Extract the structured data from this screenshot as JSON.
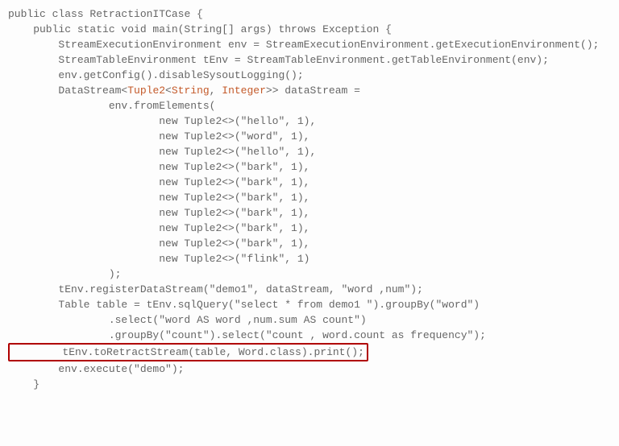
{
  "code": {
    "l1a": "public class ",
    "l1b": "RetractionITCase {",
    "l2": "    public static void main(String[] args) throws Exception {",
    "l3": "        StreamExecutionEnvironment env = StreamExecutionEnvironment.getExecutionEnvironment();",
    "l4": "        StreamTableEnvironment tEnv = StreamTableEnvironment.getTableEnvironment(env);",
    "l5": "        env.getConfig().disableSysoutLogging();",
    "l6a": "        DataStream<",
    "l6b": "Tuple2",
    "l6c": "<",
    "l6d": "String",
    "l6e": ", ",
    "l6f": "Integer",
    "l6g": ">> dataStream =",
    "l7": "                env.fromElements(",
    "l8": "                        new Tuple2<>(\"hello\", 1),",
    "l9": "                        new Tuple2<>(\"word\", 1),",
    "l10": "                        new Tuple2<>(\"hello\", 1),",
    "l11": "                        new Tuple2<>(\"bark\", 1),",
    "l12": "                        new Tuple2<>(\"bark\", 1),",
    "l13": "                        new Tuple2<>(\"bark\", 1),",
    "l14": "                        new Tuple2<>(\"bark\", 1),",
    "l15": "                        new Tuple2<>(\"bark\", 1),",
    "l16": "                        new Tuple2<>(\"bark\", 1),",
    "l17": "                        new Tuple2<>(\"flink\", 1)",
    "l18": "                );",
    "l19": "        tEnv.registerDataStream(\"demo1\", dataStream, \"word ,num\");",
    "l20": "        Table table = tEnv.sqlQuery(\"select * from demo1 \").groupBy(\"word\")",
    "l21": "                .select(\"word AS word ,num.sum AS count\")",
    "l22": "                .groupBy(\"count\").select(\"count , word.count as frequency\");",
    "l23": "        tEnv.toRetractStream(table, Word.class).print();",
    "l24": "        env.execute(\"demo\");",
    "l25": "    }"
  }
}
